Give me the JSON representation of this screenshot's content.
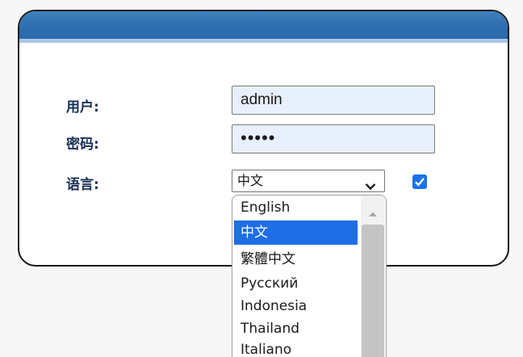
{
  "form": {
    "user_label": "用户:",
    "user_value": "admin",
    "password_label": "密码:",
    "password_value": "•••••",
    "language_label": "语言:",
    "language_selected": "中文",
    "remember_checked": true
  },
  "language_options": [
    {
      "label": "English",
      "selected": false
    },
    {
      "label": "中文",
      "selected": true
    },
    {
      "label": "繁體中文",
      "selected": false
    },
    {
      "label": "Русский",
      "selected": false
    },
    {
      "label": "Indonesia",
      "selected": false
    },
    {
      "label": "Thailand",
      "selected": false
    },
    {
      "label": "Italiano",
      "selected": false
    }
  ],
  "colors": {
    "header": "#2f6eaf",
    "field_bg": "#e8f0fe",
    "label": "#1a2f55",
    "selected_option": "#1e6ee6",
    "checkbox": "#1a73e8"
  },
  "icons": {
    "select_arrow": "chevron-down-icon",
    "checkbox_mark": "checkmark-icon",
    "scroll_up": "scroll-up-arrow-icon"
  }
}
